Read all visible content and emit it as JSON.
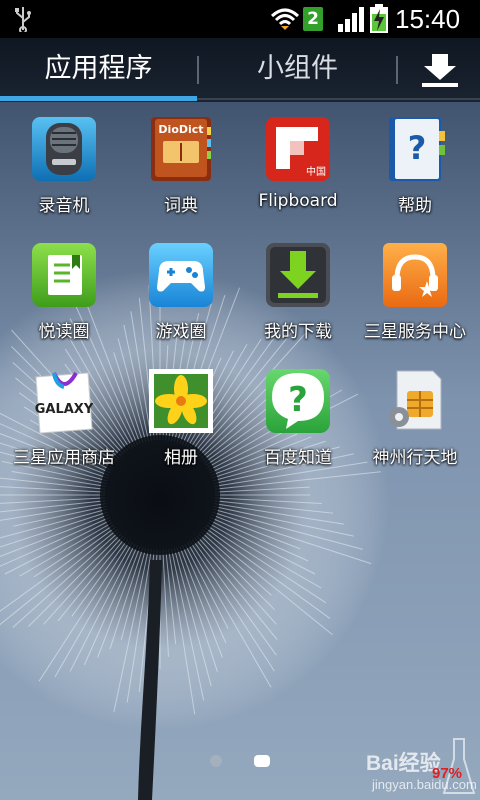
{
  "status_bar": {
    "time": "15:40",
    "sim_badge": "2",
    "icons": [
      "usb-icon",
      "wifi-icon",
      "signal-icon",
      "battery-charging-icon"
    ]
  },
  "tabs": [
    {
      "label": "应用程序",
      "selected": true
    },
    {
      "label": "小组件",
      "selected": false
    }
  ],
  "download_button": {
    "icon": "download-icon"
  },
  "apps": [
    {
      "label": "录音机",
      "icon": "voice-recorder-icon"
    },
    {
      "label": "词典",
      "icon": "dictionary-icon",
      "icon_text": "DioDict"
    },
    {
      "label": "Flipboard",
      "icon": "flipboard-icon",
      "icon_text": "中国"
    },
    {
      "label": "帮助",
      "icon": "help-icon",
      "icon_text": "?"
    },
    {
      "label": "悦读圈",
      "icon": "reading-icon"
    },
    {
      "label": "游戏圈",
      "icon": "game-icon"
    },
    {
      "label": "我的下载",
      "icon": "my-downloads-icon"
    },
    {
      "label": "三星服务中心",
      "icon": "samsung-service-icon"
    },
    {
      "label": "三星应用商店",
      "icon": "samsung-apps-icon",
      "icon_text": "GALAXY"
    },
    {
      "label": "相册",
      "icon": "gallery-icon"
    },
    {
      "label": "百度知道",
      "icon": "baidu-zhidao-icon",
      "icon_text": "?"
    },
    {
      "label": "神州行天地",
      "icon": "sim-settings-icon"
    }
  ],
  "page_indicator": {
    "pages": 2,
    "current": 2
  },
  "watermark": {
    "text": "Bai经验",
    "sub": "jingyan.baidu.com",
    "percent": "97%"
  },
  "colors": {
    "tab_accent": "#3fa6e4",
    "status_bg": "#000000"
  }
}
